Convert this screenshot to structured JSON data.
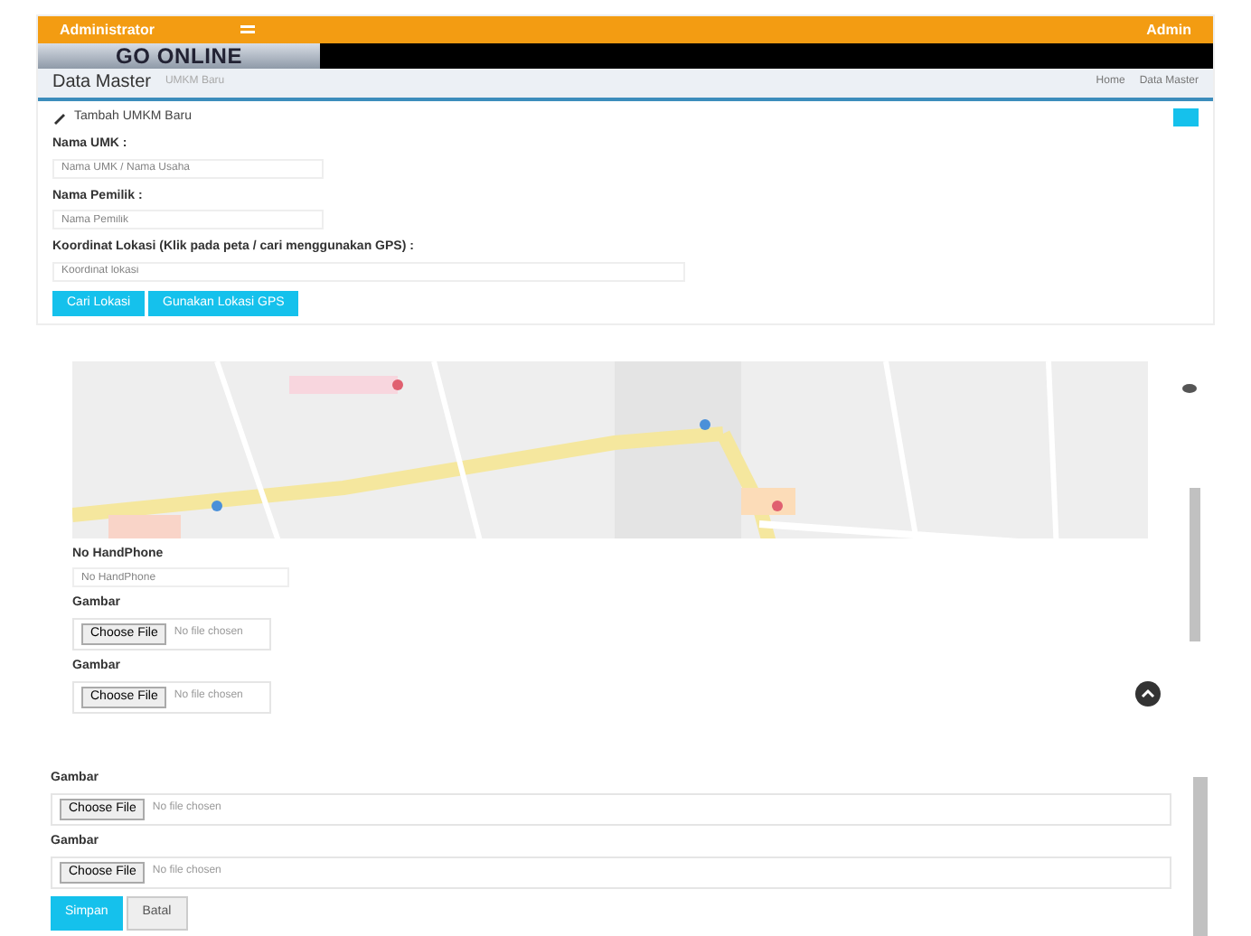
{
  "topbar": {
    "user": "Administrator",
    "account": "Admin"
  },
  "banner": {
    "title": "GO ONLINE"
  },
  "header": {
    "title": "Data Master",
    "subtitle": "UMKM Baru",
    "breadcrumb": [
      "Home",
      "Data Master"
    ]
  },
  "panel": {
    "title": "Tambah UMKM Baru"
  },
  "fields_top": [
    {
      "label": "Nama UMK :",
      "placeholder": "Nama UMK / Nama Usaha"
    },
    {
      "label": "Nama Pemilik :",
      "placeholder": "Nama Pemilik"
    },
    {
      "label": "Koordinat Lokasi (Klik pada peta / cari menggunakan GPS) :",
      "placeholder": "Koordinat lokasi"
    }
  ],
  "buttons_top": [
    "Cari Lokasi",
    "Gunakan Lokasi GPS"
  ],
  "phone": {
    "label": "No HandPhone",
    "placeholder": "No HandPhone"
  },
  "uploads_mid": [
    {
      "label": "Gambar",
      "button": "Choose File",
      "status": "No file chosen"
    },
    {
      "label": "Gambar",
      "button": "Choose File",
      "status": "No file chosen"
    }
  ],
  "uploads_bottom": [
    {
      "label": "Gambar",
      "button": "Choose File",
      "status": "No file chosen"
    },
    {
      "label": "Gambar",
      "button": "Choose File",
      "status": "No file chosen"
    }
  ],
  "actions": [
    {
      "label": "Simpan",
      "kind": "primary"
    },
    {
      "label": "Batal",
      "kind": "default"
    }
  ]
}
